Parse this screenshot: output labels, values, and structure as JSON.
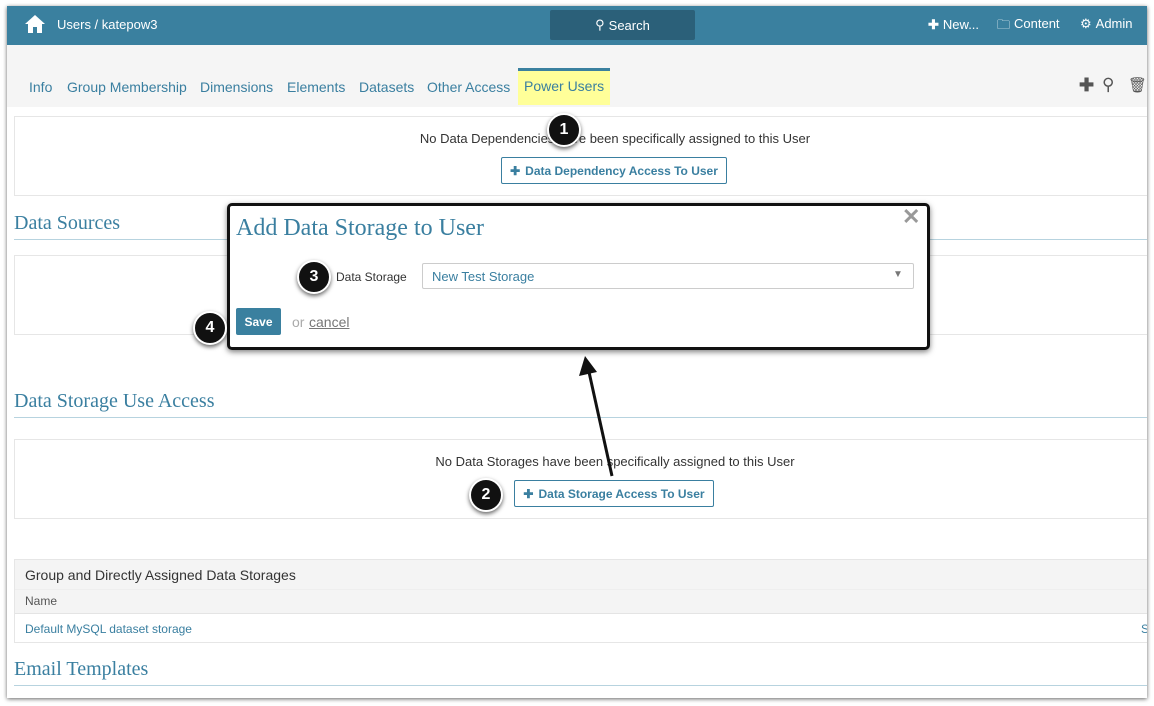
{
  "header": {
    "breadcrumb": "Users / katepow3",
    "search_label": "Search",
    "new_label": "New...",
    "content_label": "Content",
    "admin_label": "Admin"
  },
  "tabs": [
    {
      "label": "Info"
    },
    {
      "label": "Group Membership"
    },
    {
      "label": "Dimensions"
    },
    {
      "label": "Elements"
    },
    {
      "label": "Datasets"
    },
    {
      "label": "Other Access"
    },
    {
      "label": "Power Users",
      "active": true
    }
  ],
  "highlight_color": "#ffff99",
  "dependencies": {
    "message": "No Data Dependencies have been specifically assigned to this User",
    "button": "Data Dependency Access To User"
  },
  "data_sources": {
    "heading": "Data Sources"
  },
  "storage_access": {
    "heading": "Data Storage Use Access",
    "message": "No Data Storages have been specifically assigned to this User",
    "button": "Data Storage Access To User"
  },
  "table": {
    "title": "Group and Directly Assigned Data Storages",
    "columns": [
      "Name"
    ],
    "rows": [
      {
        "name": "Default MySQL dataset storage",
        "extra": "S"
      }
    ]
  },
  "email": {
    "heading": "Email Templates"
  },
  "modal": {
    "title": "Add Data Storage to User",
    "field_label": "Data Storage",
    "field_value": "New Test Storage",
    "save": "Save",
    "or": "or",
    "cancel": "cancel"
  },
  "callouts": [
    "1",
    "2",
    "3",
    "4"
  ]
}
